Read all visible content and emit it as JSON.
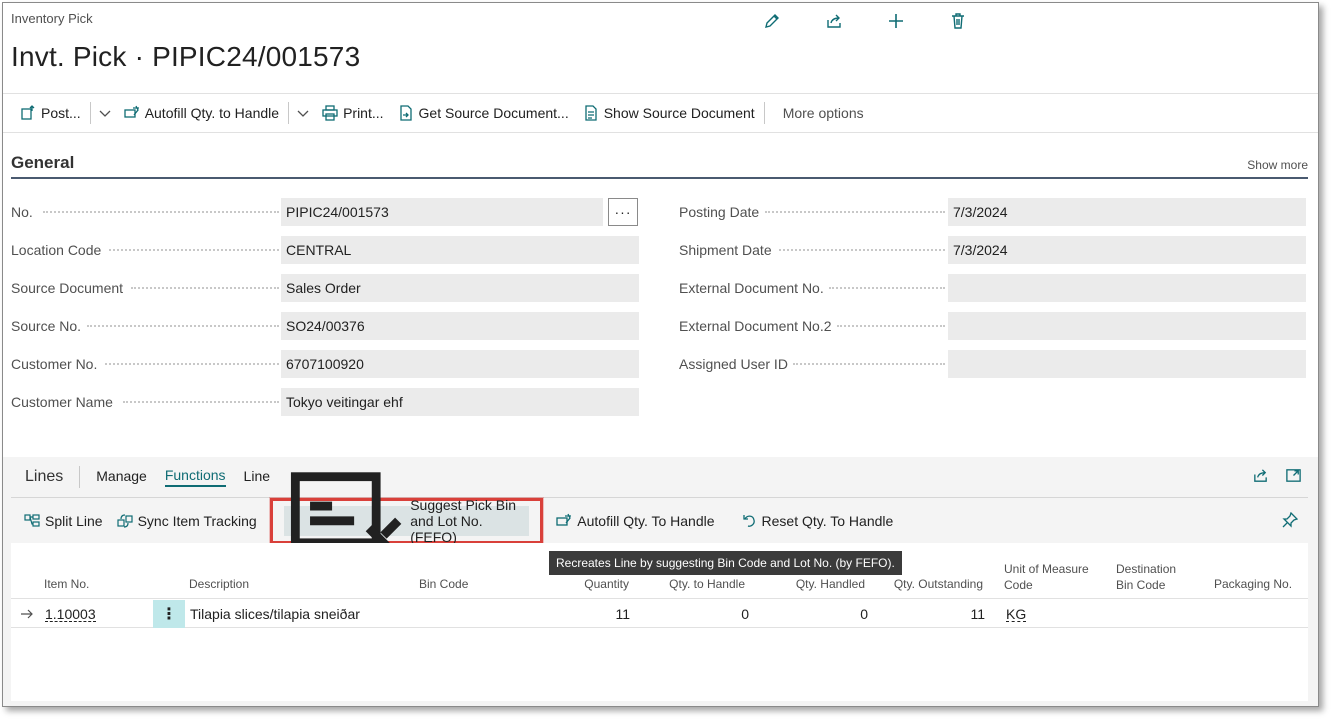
{
  "header": {
    "page_type": "Inventory Pick",
    "title": "Invt. Pick · PIPIC24/001573",
    "icons": [
      "edit-icon",
      "share-icon",
      "add-icon",
      "delete-icon"
    ]
  },
  "actions": {
    "post": "Post...",
    "autofill": "Autofill Qty. to Handle",
    "print": "Print...",
    "get_source": "Get Source Document...",
    "show_source": "Show Source Document",
    "more": "More options"
  },
  "general": {
    "title": "General",
    "show_more": "Show more",
    "left_fields": [
      {
        "label": "No.",
        "value": "PIPIC24/001573"
      },
      {
        "label": "Location Code",
        "value": "CENTRAL"
      },
      {
        "label": "Source Document",
        "value": "Sales Order"
      },
      {
        "label": "Source No.",
        "value": "SO24/00376"
      },
      {
        "label": "Customer No.",
        "value": "6707100920"
      },
      {
        "label": "Customer Name",
        "value": "Tokyo veitingar ehf"
      }
    ],
    "right_fields": [
      {
        "label": "Posting Date",
        "value": "7/3/2024"
      },
      {
        "label": "Shipment Date",
        "value": "7/3/2024"
      },
      {
        "label": "External Document No.",
        "value": ""
      },
      {
        "label": "External Document No.2",
        "value": ""
      },
      {
        "label": "Assigned User ID",
        "value": ""
      }
    ],
    "lookup_label": "···"
  },
  "lines": {
    "title": "Lines",
    "tabs": [
      "Manage",
      "Functions",
      "Line"
    ],
    "active_tab": "Functions",
    "toolbar": {
      "split_line": "Split Line",
      "sync_tracking": "Sync Item Tracking",
      "suggest_pick": "Suggest Pick Bin and Lot No. (FEFO)",
      "autofill": "Autofill Qty. To Handle",
      "reset": "Reset Qty. To Handle"
    },
    "tooltip": "Recreates Line by suggesting Bin Code and Lot No. (by FEFO).",
    "columns": {
      "item_no": "Item No.",
      "description": "Description",
      "bin_code": "Bin Code",
      "quantity": "Quantity",
      "qty_to_handle": "Qty. to Handle",
      "qty_handled": "Qty. Handled",
      "qty_outstanding": "Qty. Outstanding",
      "uom_1": "Unit of Measure",
      "uom_2": "Code",
      "dest_1": "Destination",
      "dest_2": "Bin Code",
      "packaging": "Packaging No."
    },
    "rows": [
      {
        "item_no": "1.10003",
        "kebab": "⋮",
        "description": "Tilapia slices/tilapia sneiðar",
        "bin_code": "",
        "quantity": "11",
        "qty_to_handle": "0",
        "qty_handled": "0",
        "qty_outstanding": "11",
        "uom": "KG",
        "dest_bin": "",
        "packaging": ""
      }
    ]
  },
  "colors": {
    "accent": "#0f6c74",
    "highlight_border": "#d9403a"
  }
}
